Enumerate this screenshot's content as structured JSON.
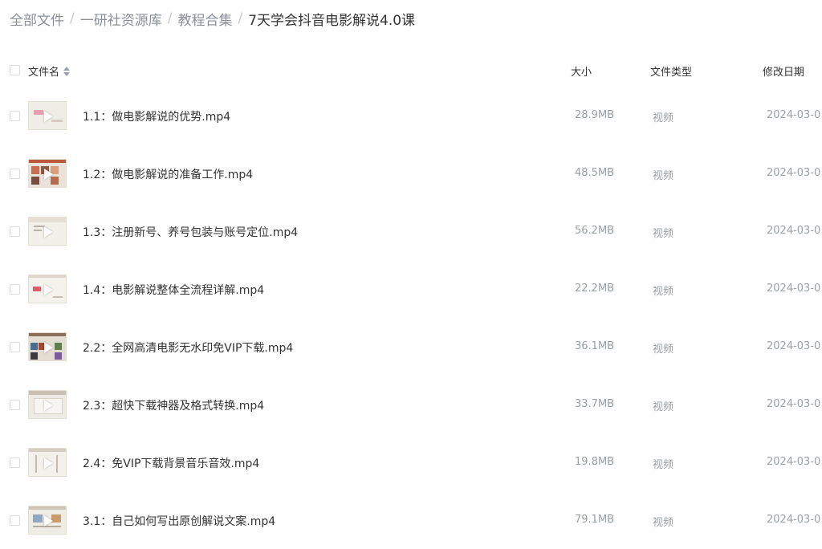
{
  "breadcrumb": {
    "items": [
      "全部文件",
      "一研社资源库",
      "教程合集"
    ],
    "current": "7天学会抖音电影解说4.0课",
    "separator": "/"
  },
  "table": {
    "headers": {
      "name": "文件名",
      "size": "大小",
      "type": "文件类型",
      "date": "修改日期"
    },
    "rows": [
      {
        "name": "1.1：做电影解说的优势.mp4",
        "size": "28.9MB",
        "type": "视频",
        "date": "2024-03-0"
      },
      {
        "name": "1.2：做电影解说的准备工作.mp4",
        "size": "48.5MB",
        "type": "视频",
        "date": "2024-03-0"
      },
      {
        "name": "1.3：注册新号、养号包装与账号定位.mp4",
        "size": "56.2MB",
        "type": "视频",
        "date": "2024-03-0"
      },
      {
        "name": "1.4：电影解说整体全流程详解.mp4",
        "size": "22.2MB",
        "type": "视频",
        "date": "2024-03-0"
      },
      {
        "name": "2.2：全网高清电影无水印免VIP下载.mp4",
        "size": "36.1MB",
        "type": "视频",
        "date": "2024-03-0"
      },
      {
        "name": "2.3：超快下载神器及格式转换.mp4",
        "size": "33.7MB",
        "type": "视频",
        "date": "2024-03-0"
      },
      {
        "name": "2.4：免VIP下载背景音乐音效.mp4",
        "size": "19.8MB",
        "type": "视频",
        "date": "2024-03-0"
      },
      {
        "name": "3.1：自己如何写出原创解说文案.mp4",
        "size": "79.1MB",
        "type": "视频",
        "date": "2024-03-0"
      }
    ]
  },
  "icons": {
    "sort": "sort-icon",
    "thumbnail": "video-thumbnail",
    "play": "play-icon"
  },
  "colors": {
    "text": "#333333",
    "muted": "#9aa0a8",
    "breadcrumb_link": "#8a8f99"
  }
}
